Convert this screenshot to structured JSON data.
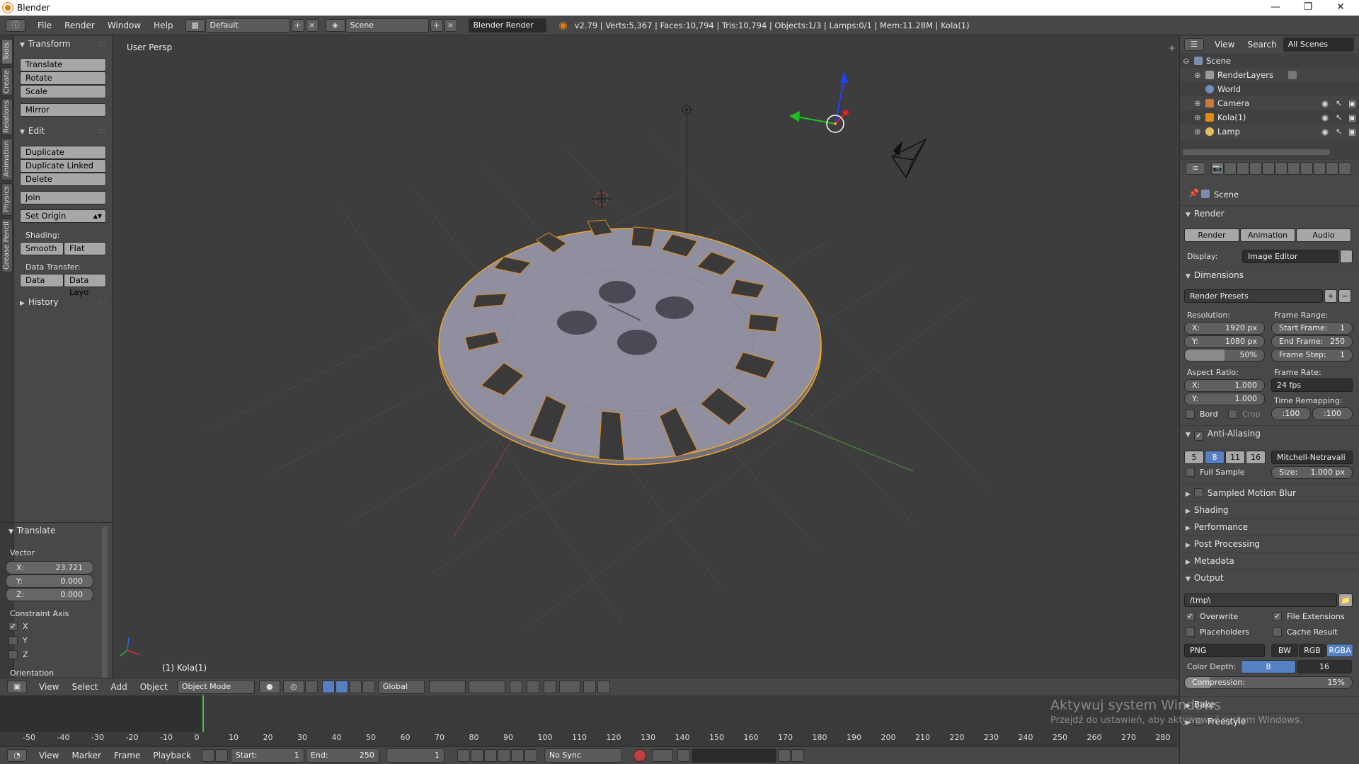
{
  "window": {
    "title": "Blender"
  },
  "menubar": {
    "items": [
      "File",
      "Render",
      "Window",
      "Help"
    ],
    "layout": "Default",
    "scene": "Scene",
    "engine": "Blender Render",
    "stats": "v2.79 | Verts:5,367 | Faces:10,794 | Tris:10,794 | Objects:1/3 | Lamps:0/1 | Mem:11.28M | Kola(1)"
  },
  "tooltabs": [
    "Tools",
    "Create",
    "Relations",
    "Animation",
    "Physics",
    "Grease Pencil"
  ],
  "toolshelf": {
    "transform_title": "Transform",
    "translate": "Translate",
    "rotate": "Rotate",
    "scale": "Scale",
    "mirror": "Mirror",
    "edit_title": "Edit",
    "duplicate": "Duplicate",
    "duplicate_linked": "Duplicate Linked",
    "delete": "Delete",
    "join": "Join",
    "set_origin": "Set Origin",
    "shading_label": "Shading:",
    "smooth": "Smooth",
    "flat": "Flat",
    "data_transfer_label": "Data Transfer:",
    "data": "Data",
    "data_layo": "Data Layo",
    "history_title": "History"
  },
  "redo_panel": {
    "title": "Translate",
    "vector_label": "Vector",
    "x_label": "X:",
    "x_value": "23.721",
    "y_label": "Y:",
    "y_value": "0.000",
    "z_label": "Z:",
    "z_value": "0.000",
    "constraint_label": "Constraint Axis",
    "axis_x": "X",
    "axis_x_checked": true,
    "axis_y": "Y",
    "axis_y_checked": false,
    "axis_z": "Z",
    "axis_z_checked": false,
    "orientation_label": "Orientation"
  },
  "viewport": {
    "view_label": "User Persp",
    "object_label": "(1) Kola(1)"
  },
  "viewport_header": {
    "view": "View",
    "select": "Select",
    "add": "Add",
    "object": "Object",
    "mode": "Object Mode",
    "orientation": "Global"
  },
  "timeline": {
    "ticks": [
      "-50",
      "-40",
      "-30",
      "-20",
      "-10",
      "0",
      "10",
      "20",
      "30",
      "40",
      "50",
      "60",
      "70",
      "80",
      "90",
      "100",
      "110",
      "120",
      "130",
      "140",
      "150",
      "160",
      "170",
      "180",
      "190",
      "200",
      "210",
      "220",
      "230",
      "240",
      "250",
      "260",
      "270",
      "280"
    ],
    "current_frame": "1",
    "menu": [
      "View",
      "Marker",
      "Frame",
      "Playback"
    ],
    "start_label": "Start:",
    "start_value": "1",
    "end_label": "End:",
    "end_value": "250",
    "sync": "No Sync"
  },
  "outliner": {
    "view": "View",
    "search": "Search",
    "filter": "All Scenes",
    "rows": [
      "Scene",
      "RenderLayers",
      "World",
      "Camera",
      "Kola(1)",
      "Lamp"
    ]
  },
  "properties": {
    "context": "Scene",
    "render_title": "Render",
    "render_btn": "Render",
    "animation_btn": "Animation",
    "audio_btn": "Audio",
    "display_label": "Display:",
    "display_value": "Image Editor",
    "dimensions_title": "Dimensions",
    "render_presets": "Render Presets",
    "resolution_label": "Resolution:",
    "res_x_label": "X:",
    "res_x": "1920 px",
    "res_y_label": "Y:",
    "res_y": "1080 px",
    "res_pct": "50%",
    "frame_range_label": "Frame Range:",
    "start_frame_label": "Start Frame:",
    "start_frame": "1",
    "end_frame_label": "End Frame:",
    "end_frame": "250",
    "frame_step_label": "Frame Step:",
    "frame_step": "1",
    "aspect_label": "Aspect Ratio:",
    "aspect_x_label": "X:",
    "aspect_x": "1.000",
    "aspect_y_label": "Y:",
    "aspect_y": "1.000",
    "frame_rate_label": "Frame Rate:",
    "frame_rate": "24 fps",
    "time_remap_label": "Time Remapping:",
    "remap_old": ":100",
    "remap_new": ":100",
    "bord": "Bord",
    "crop": "Crop",
    "aa_title": "Anti-Aliasing",
    "aa_samples": [
      "5",
      "8",
      "11",
      "16"
    ],
    "aa_selected": "8",
    "aa_filter": "Mitchell-Netravali",
    "full_sample": "Full Sample",
    "size_label": "Size:",
    "size_value": "1.000 px",
    "motion_blur_title": "Sampled Motion Blur",
    "shading_title": "Shading",
    "performance_title": "Performance",
    "post_title": "Post Processing",
    "metadata_title": "Metadata",
    "output_title": "Output",
    "output_path": "/tmp\\",
    "overwrite": "Overwrite",
    "file_extensions": "File Extensions",
    "placeholders": "Placeholders",
    "cache_result": "Cache Result",
    "format": "PNG",
    "bw": "BW",
    "rgb": "RGB",
    "rgba": "RGBA",
    "color_depth_label": "Color Depth:",
    "depth_8": "8",
    "depth_16": "16",
    "compression_label": "Compression:",
    "compression_value": "15%",
    "bake_title": "Bake",
    "freestyle_title": "Freestyle"
  },
  "watermark": {
    "line1": "Aktywuj system Windows",
    "line2": "Przejdź do ustawień, aby aktywować system Windows."
  },
  "colors": {
    "accent": "#5680c2",
    "selection_outline": "#f5a623",
    "object_fill": "#8f8fa0"
  }
}
